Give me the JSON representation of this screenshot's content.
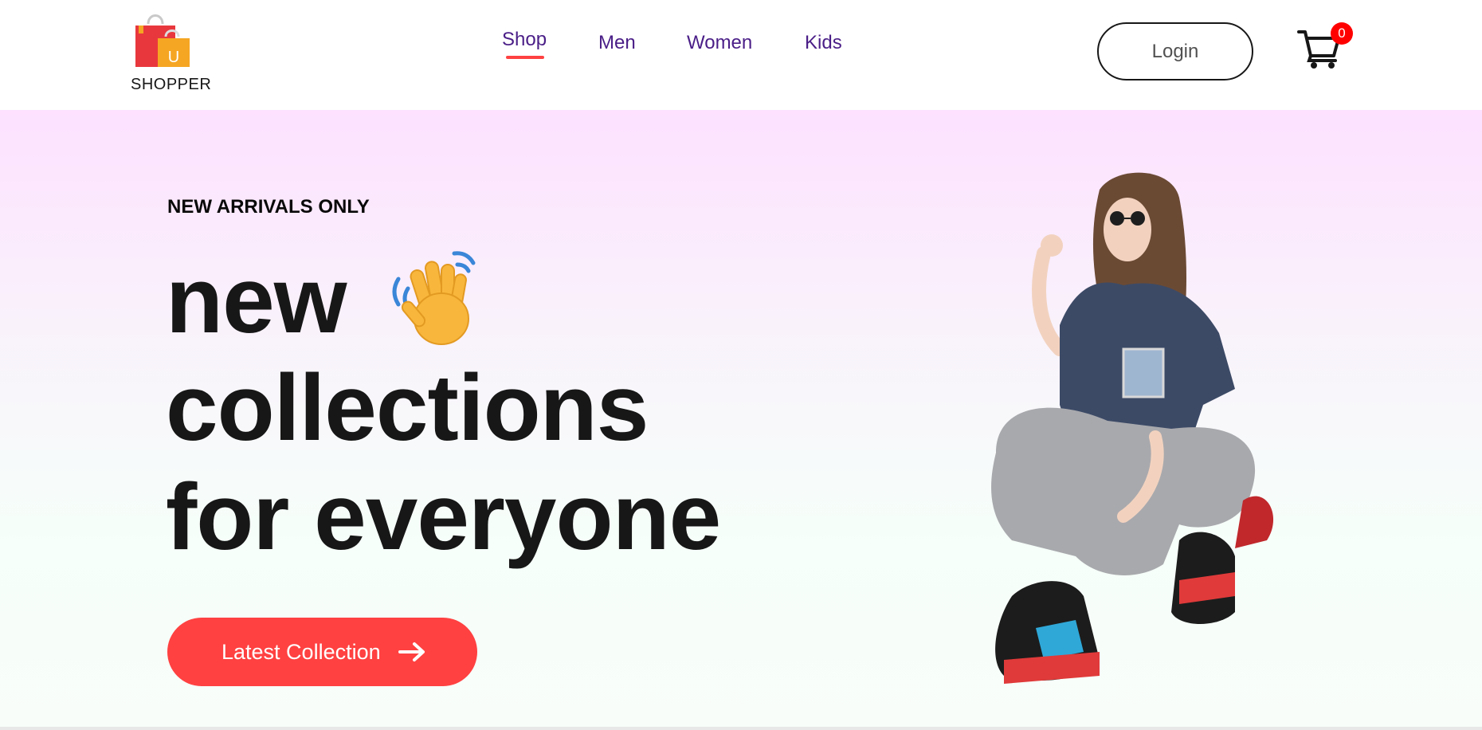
{
  "brand": {
    "name": "SHOPPER",
    "logo_letter": "U",
    "icon": "shopping-bags-icon",
    "colors": {
      "bag_red": "#e8383d",
      "bag_orange": "#f5a623"
    }
  },
  "nav": {
    "items": [
      {
        "label": "Shop",
        "active": true
      },
      {
        "label": "Men",
        "active": false
      },
      {
        "label": "Women",
        "active": false
      },
      {
        "label": "Kids",
        "active": false
      }
    ],
    "link_color": "#4a1e87",
    "active_underline_color": "#ff4141"
  },
  "header_actions": {
    "login_label": "Login",
    "cart_icon": "cart-icon",
    "cart_count": "0",
    "badge_color": "#ff0000"
  },
  "hero": {
    "kicker": "NEW ARRIVALS ONLY",
    "line1": "new",
    "line2": "collections",
    "line3": "for everyone",
    "emoji_icon": "waving-hand-icon",
    "cta_label": "Latest Collection",
    "cta_icon": "arrow-right-icon",
    "cta_color": "#ff4141",
    "image_icon": "hero-model-image",
    "gradient_top": "#fde1ff",
    "gradient_bottom": "#f6fff9"
  }
}
